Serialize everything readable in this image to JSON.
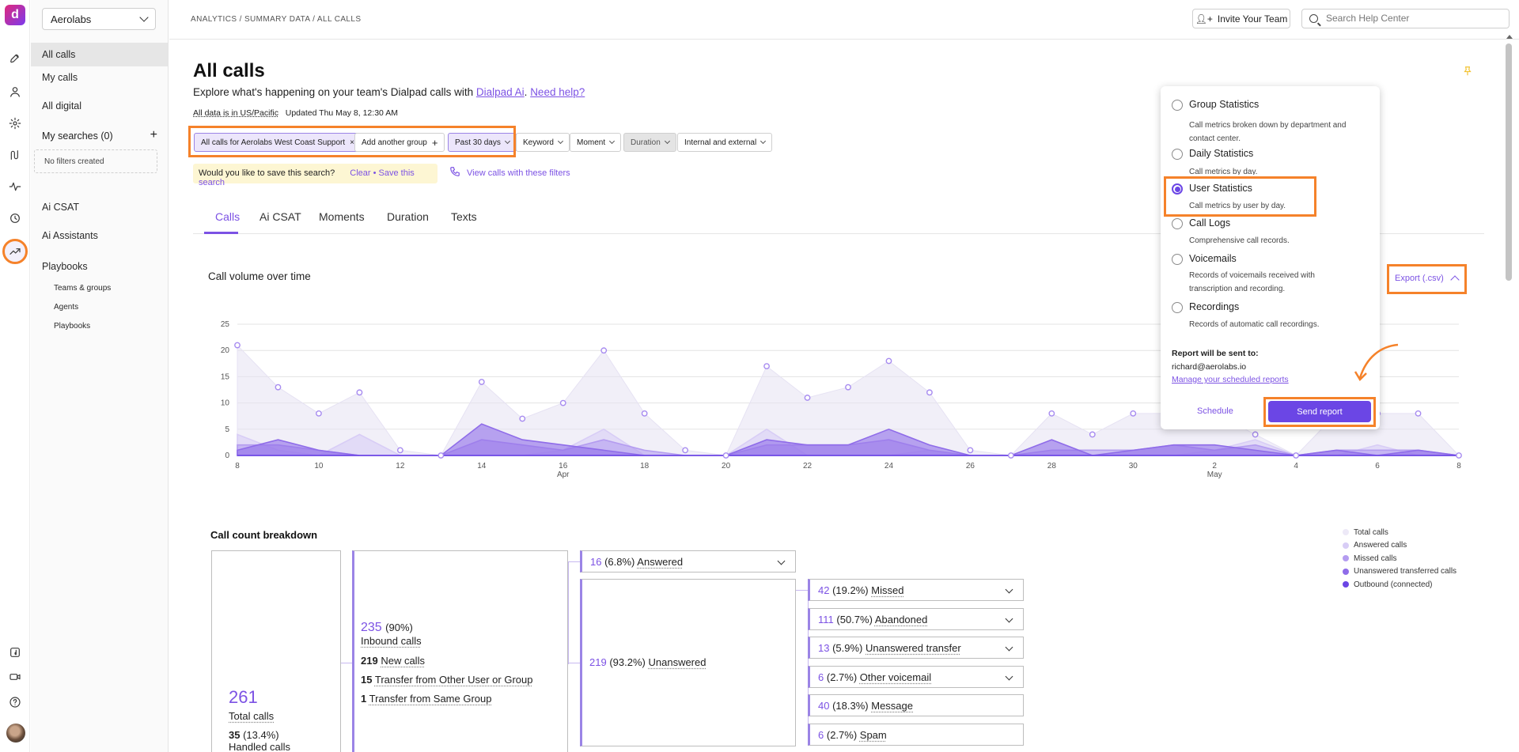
{
  "org": "Aerolabs",
  "breadcrumb": "ANALYTICS / SUMMARY DATA / ALL CALLS",
  "header": {
    "invite": "Invite Your Team",
    "help_placeholder": "Search Help Center"
  },
  "sidebar": {
    "items": [
      "All calls",
      "My calls",
      "All digital"
    ],
    "searches": "My searches (0)",
    "no_filters": "No filters created",
    "sections": [
      "Ai CSAT",
      "Ai Assistants",
      "Playbooks"
    ],
    "sub": [
      "Teams & groups",
      "Agents",
      "Playbooks"
    ]
  },
  "page": {
    "title": "All calls",
    "subtitle_prefix": "Explore what's happening on your team's Dialpad calls with ",
    "dialpad_ai": "Dialpad Ai",
    "period": ".",
    "need_help": "Need help?",
    "tz_label": "All data is in US/Pacific",
    "updated": "Updated Thu May 8, 12:30 AM"
  },
  "filters": {
    "group": "All calls for Aerolabs West Coast Support",
    "add_group": "Add another group",
    "period": "Past 30 days",
    "keyword": "Keyword",
    "moment": "Moment",
    "duration": "Duration",
    "internal": "Internal and external"
  },
  "save": {
    "question": "Would you like to save this search?",
    "actions": "Clear • Save this search",
    "view_calls": "View calls with these filters"
  },
  "tabs": [
    "Calls",
    "Ai CSAT",
    "Moments",
    "Duration",
    "Texts"
  ],
  "chart": {
    "title": "Call volume over time",
    "export": "Export (.csv)"
  },
  "chart_data": {
    "type": "area",
    "title": "Call volume over time",
    "ylim": [
      0,
      25
    ],
    "yticks": [
      0,
      5,
      10,
      15,
      20,
      25
    ],
    "xticks": [
      {
        "label": "8",
        "month": ""
      },
      {
        "label": "10",
        "month": ""
      },
      {
        "label": "12",
        "month": ""
      },
      {
        "label": "14",
        "month": ""
      },
      {
        "label": "16",
        "month": "Apr"
      },
      {
        "label": "18",
        "month": ""
      },
      {
        "label": "20",
        "month": ""
      },
      {
        "label": "22",
        "month": ""
      },
      {
        "label": "24",
        "month": ""
      },
      {
        "label": "26",
        "month": ""
      },
      {
        "label": "28",
        "month": ""
      },
      {
        "label": "30",
        "month": ""
      },
      {
        "label": "2",
        "month": "May"
      },
      {
        "label": "4",
        "month": ""
      },
      {
        "label": "6",
        "month": ""
      },
      {
        "label": "8",
        "month": ""
      }
    ],
    "series": [
      {
        "name": "Total calls",
        "color": "#e6e2f3",
        "values": [
          21,
          13,
          8,
          12,
          1,
          0,
          14,
          7,
          10,
          20,
          8,
          1,
          0,
          17,
          11,
          13,
          18,
          12,
          1,
          0,
          8,
          4,
          8,
          8,
          8,
          4,
          0,
          8,
          8,
          8,
          0
        ]
      },
      {
        "name": "Answered calls",
        "color": "#d8cdf6",
        "values": [
          4,
          1,
          0,
          4,
          0,
          0,
          0,
          0,
          1,
          5,
          0,
          0,
          0,
          5,
          0,
          0,
          0,
          1,
          0,
          0,
          0,
          0,
          0,
          0,
          1,
          3,
          0,
          0,
          2,
          0,
          0
        ]
      },
      {
        "name": "Missed calls",
        "color": "#b49cf0",
        "values": [
          2,
          2,
          1,
          0,
          0,
          0,
          3,
          2,
          1,
          3,
          1,
          0,
          0,
          2,
          2,
          2,
          3,
          1,
          0,
          0,
          1,
          1,
          1,
          2,
          1,
          2,
          0,
          1,
          1,
          1,
          0
        ]
      },
      {
        "name": "Unanswered transferred calls",
        "color": "#8f6ce9",
        "values": [
          1,
          3,
          1,
          0,
          0,
          0,
          6,
          3,
          2,
          1,
          0,
          0,
          0,
          3,
          2,
          2,
          5,
          2,
          0,
          0,
          3,
          0,
          1,
          2,
          2,
          1,
          0,
          1,
          0,
          1,
          0
        ]
      },
      {
        "name": "Outbound (connected)",
        "color": "#6b46e5",
        "values": [
          0,
          0,
          0,
          0,
          0,
          0,
          0,
          0,
          0,
          0,
          0,
          0,
          0,
          0,
          0,
          0,
          0,
          0,
          0,
          0,
          0,
          0,
          0,
          0,
          0,
          0,
          0,
          0,
          0,
          0,
          0
        ]
      }
    ],
    "markers": [
      21,
      13,
      8,
      12,
      1,
      0,
      14,
      7,
      10,
      20,
      8,
      1,
      0,
      17,
      11,
      13,
      18,
      12,
      1,
      0,
      8,
      4,
      8,
      8,
      8,
      4,
      0,
      8,
      8,
      8,
      0
    ]
  },
  "breakdown": {
    "title": "Call count breakdown",
    "total_num": "261",
    "total_label": "Total calls",
    "handled_pre": "35",
    "handled_pct": "(13.4%)",
    "handled_label": "Handled calls",
    "inbound_num": "235",
    "inbound_pct": "(90%)",
    "inbound_label": "Inbound calls",
    "new_num": "219",
    "new_label": "New calls",
    "transfer_other_num": "15",
    "transfer_other_label": "Transfer from Other User or Group",
    "transfer_same_num": "1",
    "transfer_same_label": "Transfer from Same Group",
    "answered_num": "16",
    "answered_pct": "(6.8%)",
    "answered_label": "Answered",
    "unanswered_num": "219",
    "unanswered_pct": "(93.2%)",
    "unanswered_label": "Unanswered",
    "rows": [
      {
        "num": "42",
        "pct": "(19.2%)",
        "label": "Missed",
        "dd": true
      },
      {
        "num": "111",
        "pct": "(50.7%)",
        "label": "Abandoned",
        "dd": true
      },
      {
        "num": "13",
        "pct": "(5.9%)",
        "label": "Unanswered transfer",
        "dd": true
      },
      {
        "num": "6",
        "pct": "(2.7%)",
        "label": "Other voicemail",
        "dd": true
      },
      {
        "num": "40",
        "pct": "(18.3%)",
        "label": "Message",
        "dd": false
      },
      {
        "num": "6",
        "pct": "(2.7%)",
        "label": "Spam",
        "dd": false
      }
    ]
  },
  "legend": [
    "Total calls",
    "Answered calls",
    "Missed calls",
    "Unanswered transferred calls",
    "Outbound (connected)"
  ],
  "legend_colors": [
    "#ede9f7",
    "#d8cdf6",
    "#b49cf0",
    "#8f6ce9",
    "#6b46e5"
  ],
  "popup": {
    "options": [
      {
        "title": "Group Statistics",
        "desc": "Call metrics broken down by department and contact center.",
        "selected": false
      },
      {
        "title": "Daily Statistics",
        "desc": "Call metrics by day.",
        "selected": false
      },
      {
        "title": "User Statistics",
        "desc": "Call metrics by user by day.",
        "selected": true
      },
      {
        "title": "Call Logs",
        "desc": "Comprehensive call records.",
        "selected": false
      },
      {
        "title": "Voicemails",
        "desc": "Records of voicemails received with transcription and recording.",
        "selected": false
      },
      {
        "title": "Recordings",
        "desc": "Records of automatic call recordings.",
        "selected": false
      }
    ],
    "sent_to_label": "Report will be sent to:",
    "email": "richard@aerolabs.io",
    "manage": "Manage your scheduled reports",
    "schedule": "Schedule",
    "send": "Send report"
  },
  "accent": "#7c52e4",
  "highlight": "#f5822a"
}
